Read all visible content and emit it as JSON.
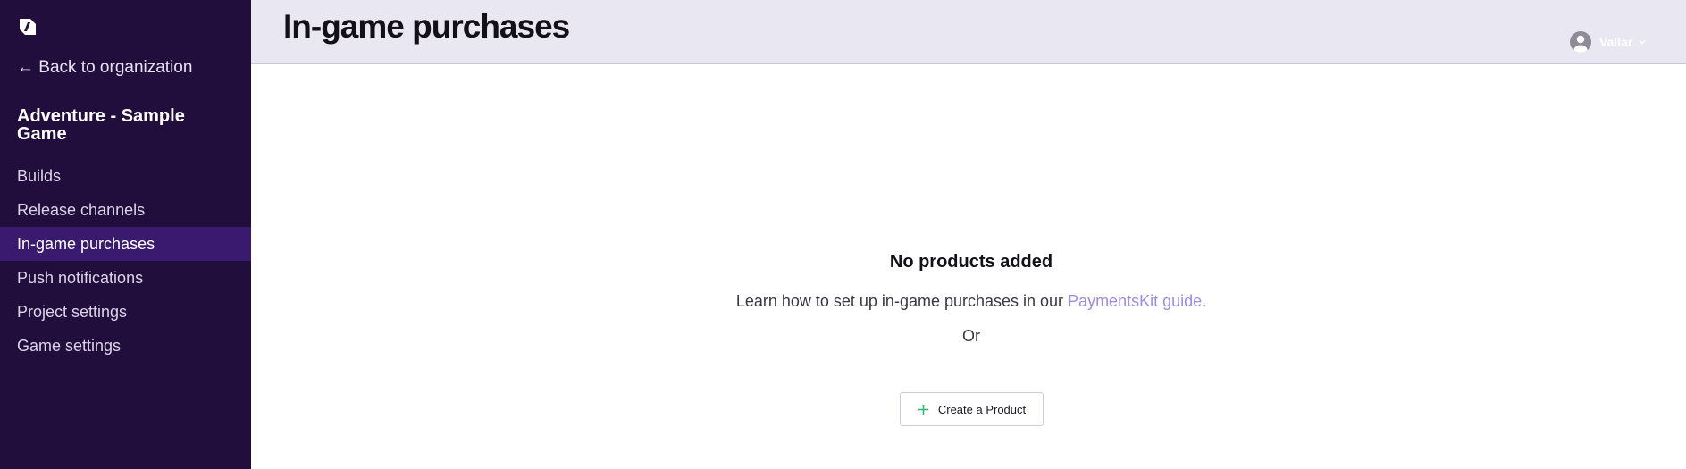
{
  "sidebar": {
    "logo_icon": "game-logo-icon",
    "back_label": "← Back to organization",
    "project_title": "Adventure - Sample Game",
    "items": [
      {
        "label": "Builds",
        "active": false
      },
      {
        "label": "Release channels",
        "active": false
      },
      {
        "label": "In-game purchases",
        "active": true
      },
      {
        "label": "Push notifications",
        "active": false
      },
      {
        "label": "Project settings",
        "active": false
      },
      {
        "label": "Game settings",
        "active": false
      }
    ]
  },
  "header": {
    "title": "In-game purchases",
    "user": {
      "name": "Vallar",
      "avatar_icon": "user-avatar-icon",
      "menu_icon": "chevron-down-icon"
    }
  },
  "main": {
    "empty_title": "No products added",
    "empty_desc_prefix": "Learn how to set up in-game purchases in our ",
    "guide_link": "PaymentsKit guide",
    "empty_desc_suffix": ".",
    "or_text": "Or",
    "create_button": "Create a Product",
    "create_icon": "plus-icon"
  },
  "colors": {
    "sidebar_bg": "#220e3c",
    "sidebar_active": "#3a1a6e",
    "header_bg": "#e9e7f1",
    "link": "#9e8ce0",
    "plus_icon": "#2eb872"
  }
}
